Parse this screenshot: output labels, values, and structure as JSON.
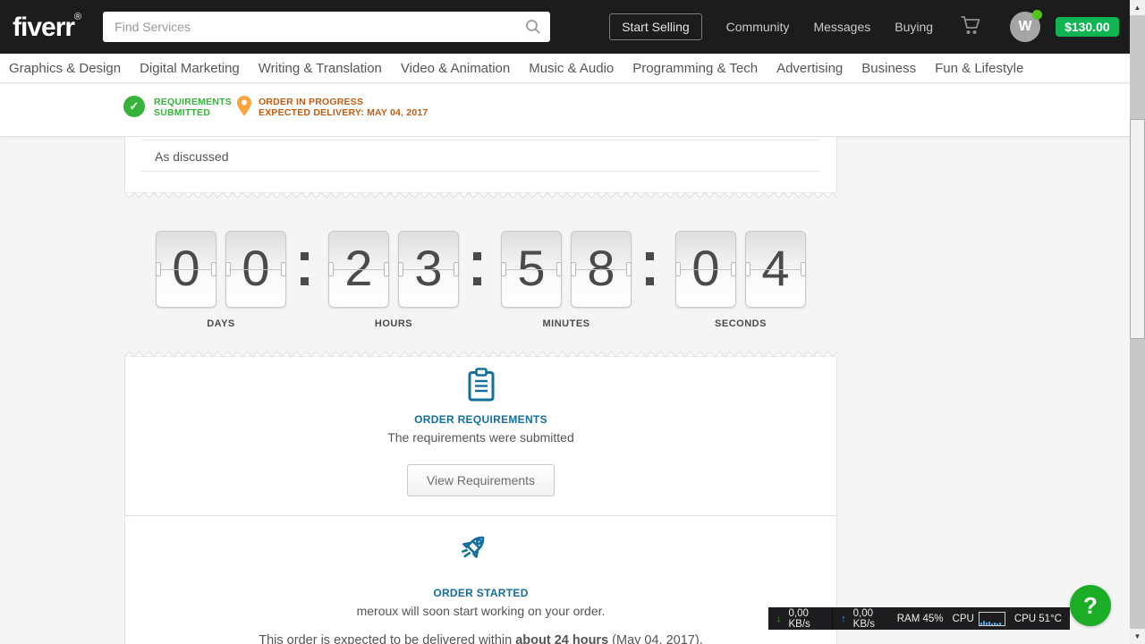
{
  "header": {
    "logo": "fiverr",
    "logo_reg": "®",
    "search_placeholder": "Find Services",
    "start_selling": "Start Selling",
    "nav": [
      "Community",
      "Messages",
      "Buying"
    ],
    "avatar_initial": "W",
    "balance": "$130.00"
  },
  "categories": [
    "Graphics & Design",
    "Digital Marketing",
    "Writing & Translation",
    "Video & Animation",
    "Music & Audio",
    "Programming & Tech",
    "Advertising",
    "Business",
    "Fun & Lifestyle"
  ],
  "order_status": {
    "step1_line1": "REQUIREMENTS",
    "step1_line2": "SUBMITTED",
    "step2_line1": "ORDER IN PROGRESS",
    "step2_line2": "EXPECTED DELIVERY: MAY 04, 2017"
  },
  "conversation": {
    "message": "As discussed"
  },
  "countdown": {
    "digits": [
      "0",
      "0",
      "2",
      "3",
      "5",
      "8",
      "0",
      "4"
    ],
    "labels": [
      "DAYS",
      "HOURS",
      "MINUTES",
      "SECONDS"
    ]
  },
  "requirements": {
    "title": "ORDER REQUIREMENTS",
    "subtitle": "The requirements were submitted",
    "button": "View Requirements"
  },
  "started": {
    "title": "ORDER STARTED",
    "subtitle": "meroux will soon start working on your order.",
    "delivery_prefix": "This order is expected to be delivered within ",
    "delivery_bold": "about 24 hours",
    "delivery_suffix": " (May 04, 2017)."
  },
  "monitor": {
    "down_speed": "0,00 KB/s",
    "up_speed": "0,00 KB/s",
    "ram": "RAM 45%",
    "cpu_label": "CPU",
    "cpu_temp": "CPU 51°C"
  },
  "help": {
    "label": "?"
  },
  "icons": {
    "check": "✓",
    "down_arrow": "↓",
    "up_arrow": "↑",
    "scroll_up": "▲",
    "scroll_down": "▼"
  },
  "colors": {
    "header_bg": "#1c1c1c",
    "accent_green": "#10b452",
    "status_green": "#35b43a",
    "status_orange": "#c25c10",
    "pin_orange": "#f9a43f",
    "teal": "#146e9e",
    "help_green": "#1aad25"
  }
}
